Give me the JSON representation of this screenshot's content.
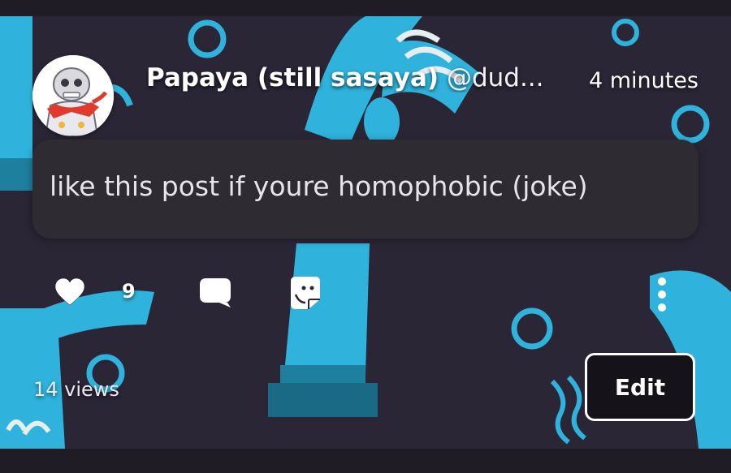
{
  "post": {
    "author_name": "Papaya (still sasaya)",
    "author_handle": "@dud...",
    "timestamp": "4 minutes",
    "text": "like this post if youre homophobic (joke)",
    "like_count": "9",
    "views": "14 views"
  },
  "actions": {
    "edit_label": "Edit"
  },
  "icons": {
    "like": "heart-icon",
    "comment": "speech-bubble-icon",
    "share": "sticker-icon",
    "more": "vertical-ellipsis-icon"
  },
  "colors": {
    "card_background": "#2a2636",
    "accent": "#2fb3dc",
    "bubble": "#2e2b33",
    "edit_button": "#15121a"
  }
}
